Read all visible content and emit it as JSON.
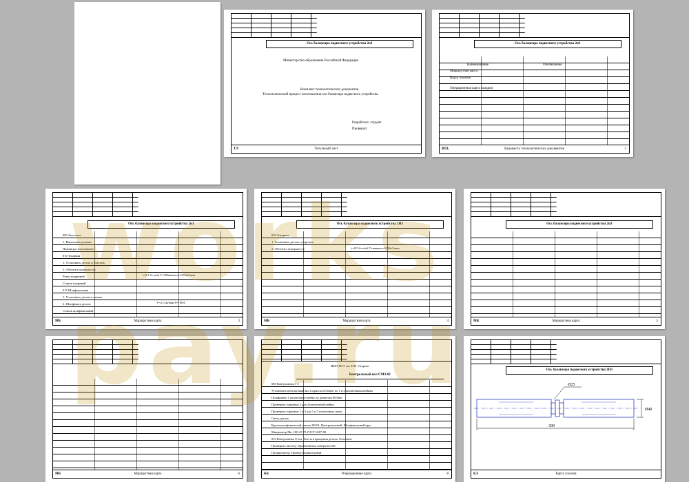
{
  "watermark": "works pay.ru",
  "page2": {
    "title": "Ось балансира подвесного устройства 2н3",
    "ministry": "Министерство образования Российской Федерации",
    "heading1": "Комплект технологических документов",
    "heading2": "Технологический процесс изготовления оси балансира подвесного устройства.",
    "developed": "Разработал: студент",
    "checked": "Проверил:",
    "footer_code": "ТЛ",
    "footer_title": "Титульный лист"
  },
  "page3": {
    "title": "Ось балансира подвесного устройства 2н3",
    "col1": "Наименование",
    "col2": "Обозначение",
    "item1": "Маршрутная карта",
    "item2": "Карта эскизов",
    "item3": "Операционная карта наладки",
    "footer_code": "ВТД",
    "footer_title": "Ведомость технологических документов",
    "footer_num": "2"
  },
  "route1": {
    "title": "Ось балансира подвесного устройства 2н3",
    "lines": [
      "005 Заготовка",
      "1. Выполнить резание",
      "Ножницы гильотинные",
      "",
      "010 Токарная",
      "1. Установить деталь и отрезать",
      "2. Обточить поверхность",
      "Резец подрезной",
      "Станок токарный",
      "",
      "015 Шлифовальная",
      "1. Установить деталь в станок",
      "2. Шлифовать деталь",
      "Станок шлифовальный"
    ],
    "param1": "t=0,1 S=ω/об Т=100ммин n=1276об/мин",
    "param2": "V=21,5м/мин S=100А",
    "footer_code": "МК",
    "footer_title": "Маршрутная карта",
    "footer_num": "3"
  },
  "route2": {
    "title": "Ось балансира подвесного устройства 2Н3",
    "lines": [
      "020 Токарная",
      "1. Установить деталь и отрезать",
      "2. Обточить поверхность"
    ],
    "param1": "t=0,5 S=ω/об T=ммин n=1059об/мин",
    "footer_code": "МК",
    "footer_title": "Маршрутная карта",
    "footer_num": "4"
  },
  "route3": {
    "title": "Ось балансира подвесного устройства 2н3",
    "footer_code": "МК",
    "footer_title": "Маршрутная карта",
    "footer_num": "5"
  },
  "route4": {
    "footer_code": "МК",
    "footer_title": "Маршрутная карта",
    "footer_num": "6"
  },
  "control": {
    "org": "ИМЭ МГУ им. Н.П. Огарева",
    "title": "Контрольный вал СМЗ-02",
    "lines": [
      "005 Контрольная 1-5",
      "Установить кобальтовый вал в приспособление по 1 и 4 шпоночным шейкам",
      "Шлифовать 1 шпоночную шейку до диаметра 60,8нм",
      "Проверить торцевые 2 для 4 шпоночной шейки",
      "Проверить торцевые 1 и 3 для 1 и 3 шпоночных шеек",
      "Снять деталь",
      "Круглошлифовальный станок 3Б161. Центровальный. Шлифовальный круг",
      "Микрометр Мк. 100-25-75 ГОСТ 6507-90",
      "010 Контрольная 11 шт. Чистота вращения детали. Освоение",
      "Проверить чистоту обработанных поверхностей",
      "Профилометр. Прибор индикаторный"
    ],
    "footer_code": "КК",
    "footer_title": "Операционная карта",
    "footer_num": "8"
  },
  "sketch": {
    "title": "Ось балансира подвесного устройства 2Н3",
    "dim_len": "300",
    "dim_dia": "Ø40",
    "dim_key": "Ø25",
    "footer_code": "КЭ",
    "footer_title": "Карта эскизов"
  }
}
